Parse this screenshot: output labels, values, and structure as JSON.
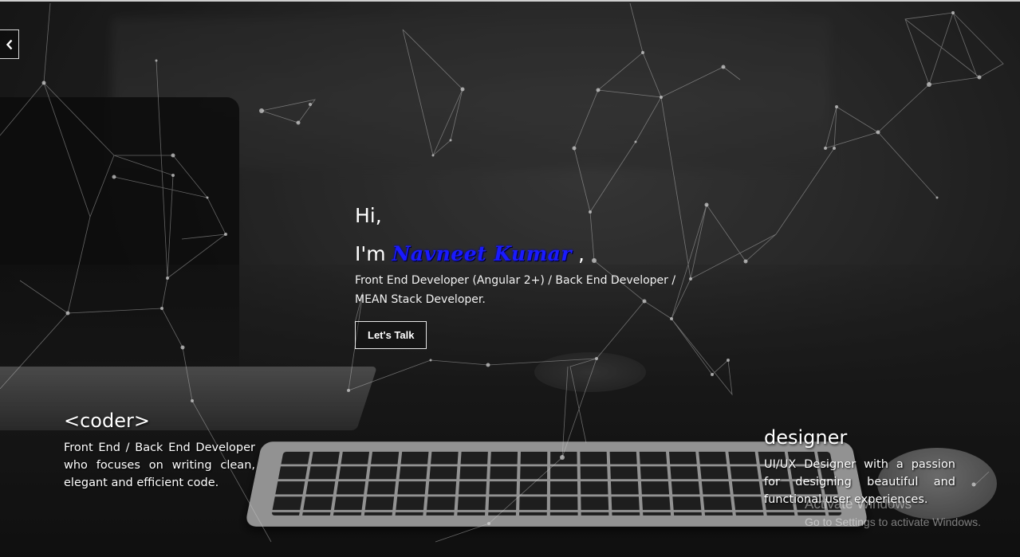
{
  "nav": {
    "back_icon": "chevron-left-icon"
  },
  "hero": {
    "greeting": "Hi,",
    "intro_prefix": "I'm",
    "name": "Navneet Kumar",
    "intro_suffix": ",",
    "role": "Front End Developer (Angular 2+) / Back End Developer / MEAN Stack Developer.",
    "cta_label": "Let's Talk"
  },
  "coder": {
    "title": "<coder>",
    "description": "Front End / Back End Developer who focuses on writing clean, elegant and efficient code."
  },
  "designer": {
    "title": "designer",
    "description": "UI/UX Designer with a passion for designing beautiful and functional user experiences."
  },
  "watermark": {
    "title": "Activate Windows",
    "subtitle": "Go to Settings to activate Windows."
  },
  "colors": {
    "name_accent": "#1a1aff",
    "network_line": "#cfcfcf",
    "background": "#1b1b1b"
  }
}
